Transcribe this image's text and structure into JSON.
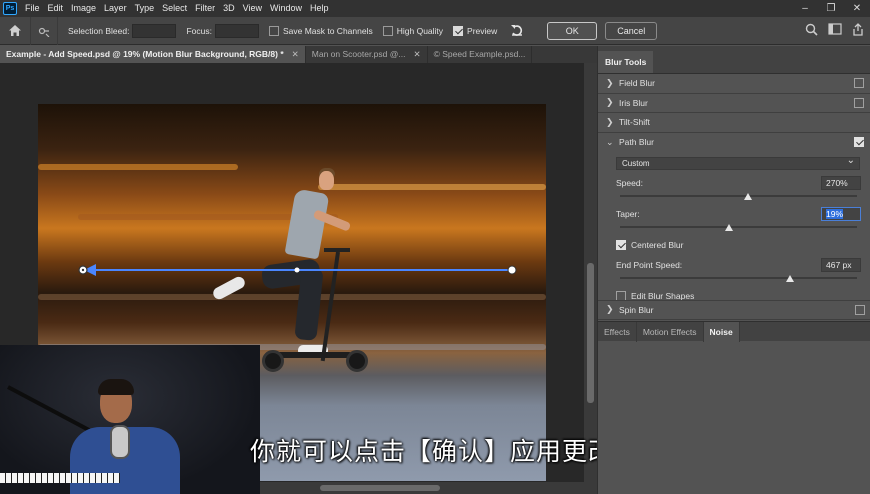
{
  "app": {
    "logo": "Ps"
  },
  "menu": [
    "File",
    "Edit",
    "Image",
    "Layer",
    "Type",
    "Select",
    "Filter",
    "3D",
    "View",
    "Window",
    "Help"
  ],
  "window_controls": [
    "–",
    "❐",
    "✕"
  ],
  "options_bar": {
    "selection_bleed_label": "Selection Bleed:",
    "focus_label": "Focus:",
    "save_mask_label": "Save Mask to Channels",
    "save_mask_checked": false,
    "high_quality_label": "High Quality",
    "high_quality_checked": false,
    "preview_label": "Preview",
    "preview_checked": true,
    "ok_label": "OK",
    "cancel_label": "Cancel"
  },
  "tabs": [
    {
      "label": "Example - Add Speed.psd @ 19% (Motion Blur Background, RGB/8) *",
      "active": true
    },
    {
      "label": "Man on Scooter.psd @...",
      "active": false
    },
    {
      "label": "© Speed Example.psd...",
      "active": false
    }
  ],
  "subtitle": "你就可以点击【确认】应用更改",
  "panel": {
    "title": "Blur Tools",
    "sections": [
      {
        "label": "Field Blur",
        "checked": false,
        "expanded": false
      },
      {
        "label": "Iris Blur",
        "checked": false,
        "expanded": false
      },
      {
        "label": "Tilt-Shift",
        "checked": false,
        "expanded": false
      },
      {
        "label": "Path Blur",
        "checked": true,
        "expanded": true
      }
    ],
    "path_blur": {
      "preset": "Custom",
      "speed_label": "Speed:",
      "speed_value": "270%",
      "speed_pos": 0.54,
      "taper_label": "Taper:",
      "taper_value": "19%",
      "taper_pos": 0.46,
      "centered_label": "Centered Blur",
      "centered_checked": true,
      "endpoint_label": "End Point Speed:",
      "endpoint_value": "467 px",
      "endpoint_pos": 0.71,
      "edit_shapes_label": "Edit Blur Shapes",
      "edit_shapes_checked": false
    },
    "spin_blur": {
      "label": "Spin Blur",
      "checked": false
    },
    "bottom_tabs": [
      {
        "label": "Effects",
        "active": false
      },
      {
        "label": "Motion Effects",
        "active": false
      },
      {
        "label": "Noise",
        "active": true
      }
    ]
  }
}
